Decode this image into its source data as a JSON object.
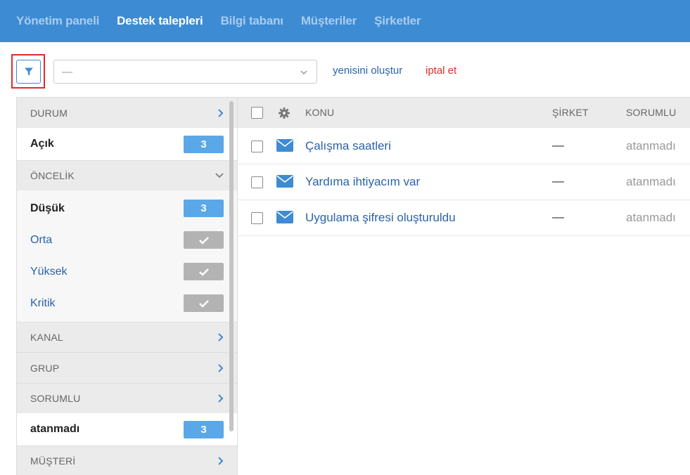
{
  "topnav": {
    "items": [
      {
        "label": "Yönetim paneli",
        "active": false
      },
      {
        "label": "Destek talepleri",
        "active": true
      },
      {
        "label": "Bilgi tabanı",
        "active": false
      },
      {
        "label": "Müşteriler",
        "active": false
      },
      {
        "label": "Şirketler",
        "active": false
      }
    ]
  },
  "toolbar": {
    "filter_icon": "filter-icon",
    "select_value": "—",
    "create_new_label": "yenisini oluştur",
    "cancel_label": "iptal et"
  },
  "sidebar": {
    "durum": {
      "header": "DURUM",
      "items": [
        {
          "label": "Açık",
          "count": "3"
        }
      ]
    },
    "oncelik": {
      "header": "ÖNCELİK",
      "items": [
        {
          "label": "Düşük",
          "count": "3"
        },
        {
          "label": "Orta",
          "checked": true
        },
        {
          "label": "Yüksek",
          "checked": true
        },
        {
          "label": "Kritik",
          "checked": true
        }
      ]
    },
    "kanal": {
      "header": "KANAL"
    },
    "grup": {
      "header": "GRUP"
    },
    "sorumlu": {
      "header": "SORUMLU",
      "items": [
        {
          "label": "atanmadı",
          "count": "3"
        }
      ]
    },
    "musteri": {
      "header": "MÜŞTERİ"
    }
  },
  "table": {
    "columns": {
      "subject": "KONU",
      "company": "ŞİRKET",
      "assignee": "SORUMLU"
    },
    "rows": [
      {
        "subject": "Çalışma saatleri",
        "company": "—",
        "assignee": "atanmadı"
      },
      {
        "subject": "Yardıma ihtiyacım var",
        "company": "—",
        "assignee": "atanmadı"
      },
      {
        "subject": "Uygulama şifresi oluşturuldu",
        "company": "—",
        "assignee": "atanmadı"
      }
    ]
  },
  "colors": {
    "nav_bg": "#3d8bd3",
    "link": "#2a63a8",
    "danger": "#e02b2b",
    "badge": "#5aa8e8",
    "check_badge": "#b3b3b3"
  }
}
